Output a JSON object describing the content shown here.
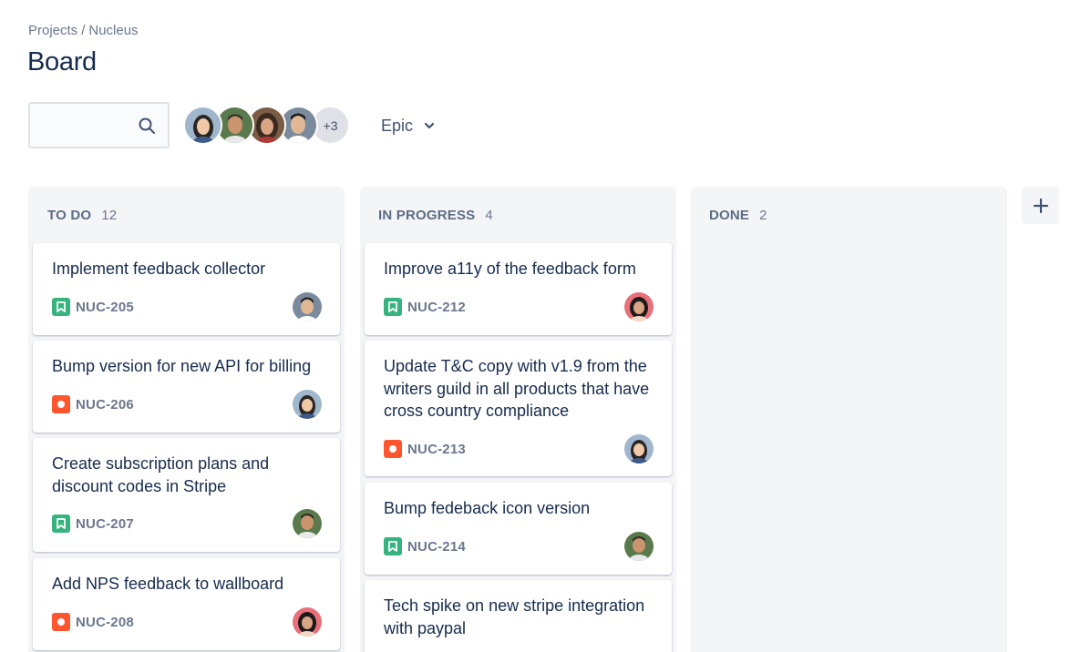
{
  "breadcrumb": {
    "projects": "Projects",
    "separator": "/",
    "project": "Nucleus"
  },
  "page_title": "Board",
  "search": {
    "value": "",
    "placeholder": ""
  },
  "avatar_group": {
    "more_label": "+3"
  },
  "epic_filter": {
    "label": "Epic"
  },
  "add_column_label": "+",
  "columns": [
    {
      "title": "TO DO",
      "count": "12",
      "cards": [
        {
          "title": "Implement feedback collector",
          "key": "NUC-205",
          "type": "story"
        },
        {
          "title": "Bump version for new API for billing",
          "key": "NUC-206",
          "type": "bug"
        },
        {
          "title": "Create subscription plans and discount codes in Stripe",
          "key": "NUC-207",
          "type": "story"
        },
        {
          "title": "Add NPS feedback to wallboard",
          "key": "NUC-208",
          "type": "bug"
        }
      ]
    },
    {
      "title": "IN PROGRESS",
      "count": "4",
      "cards": [
        {
          "title": "Improve a11y of the feedback form",
          "key": "NUC-212",
          "type": "story"
        },
        {
          "title": "Update T&C copy with v1.9 from the writers guild in all products that have cross country compliance",
          "key": "NUC-213",
          "type": "bug"
        },
        {
          "title": "Bump fedeback icon version",
          "key": "NUC-214",
          "type": "story"
        },
        {
          "title": "Tech spike on new stripe integration with paypal",
          "key": "",
          "type": ""
        }
      ]
    },
    {
      "title": "DONE",
      "count": "2",
      "cards": []
    }
  ],
  "colors": {
    "story": "#36b37e",
    "bug": "#ff5630",
    "column_bg": "#f4f5f7",
    "text_primary": "#172b4d",
    "text_secondary": "#6b778c"
  }
}
